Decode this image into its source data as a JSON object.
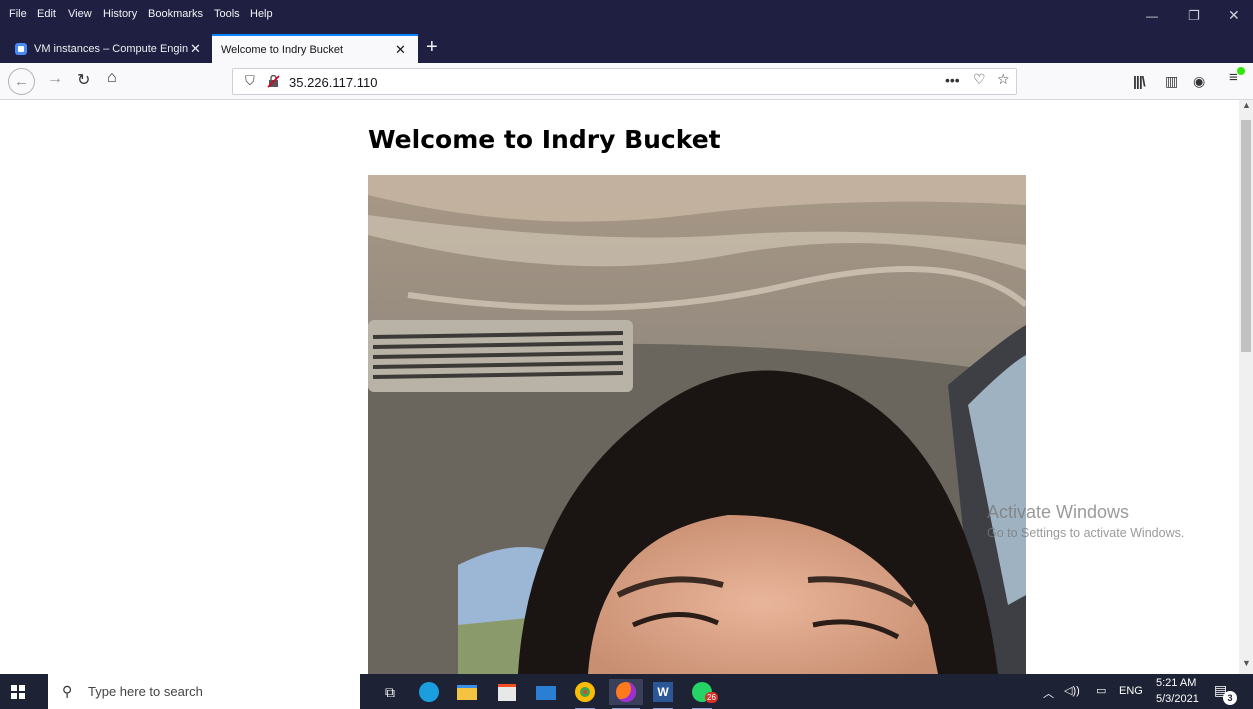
{
  "menubar": {
    "items": [
      "File",
      "Edit",
      "View",
      "History",
      "Bookmarks",
      "Tools",
      "Help"
    ]
  },
  "tabs": [
    {
      "title": "VM instances – Compute Engin",
      "active": false
    },
    {
      "title": "Welcome to Indry Bucket",
      "active": true
    }
  ],
  "navbar": {
    "url": "35.226.117.110",
    "page_actions_label": "•••"
  },
  "page": {
    "heading": "Welcome to Indry Bucket",
    "image_alt": "selfie photo"
  },
  "watermark": {
    "line1": "Activate Windows",
    "line2": "Go to Settings to activate Windows."
  },
  "taskbar": {
    "search_placeholder": "Type here to search",
    "whatsapp_badge": "26",
    "language": "ENG",
    "time": "5:21 AM",
    "date": "5/3/2021",
    "notification_count": "3"
  },
  "colors": {
    "chrome_dark": "#1f2041",
    "accent": "#0a84ff",
    "taskbar": "#1e2235"
  }
}
